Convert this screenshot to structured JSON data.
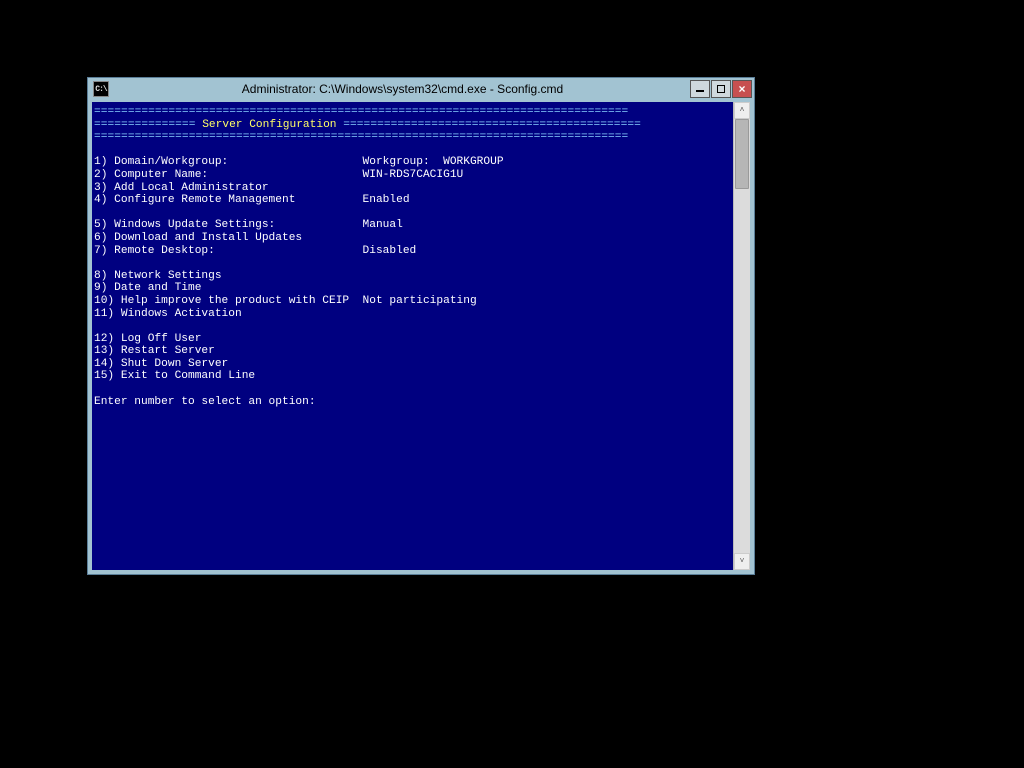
{
  "window": {
    "title": "Administrator: C:\\Windows\\system32\\cmd.exe - Sconfig.cmd"
  },
  "header": {
    "title_text": "Server Configuration"
  },
  "menu": {
    "items": [
      {
        "num": "1)",
        "label": "Domain/Workgroup:",
        "value": "Workgroup:  WORKGROUP"
      },
      {
        "num": "2)",
        "label": "Computer Name:",
        "value": "WIN-RDS7CACIG1U"
      },
      {
        "num": "3)",
        "label": "Add Local Administrator",
        "value": ""
      },
      {
        "num": "4)",
        "label": "Configure Remote Management",
        "value": "Enabled"
      },
      {
        "num": "",
        "label": "",
        "value": ""
      },
      {
        "num": "5)",
        "label": "Windows Update Settings:",
        "value": "Manual"
      },
      {
        "num": "6)",
        "label": "Download and Install Updates",
        "value": ""
      },
      {
        "num": "7)",
        "label": "Remote Desktop:",
        "value": "Disabled"
      },
      {
        "num": "",
        "label": "",
        "value": ""
      },
      {
        "num": "8)",
        "label": "Network Settings",
        "value": ""
      },
      {
        "num": "9)",
        "label": "Date and Time",
        "value": ""
      },
      {
        "num": "10)",
        "label": "Help improve the product with CEIP",
        "value": "Not participating"
      },
      {
        "num": "11)",
        "label": "Windows Activation",
        "value": ""
      },
      {
        "num": "",
        "label": "",
        "value": ""
      },
      {
        "num": "12)",
        "label": "Log Off User",
        "value": ""
      },
      {
        "num": "13)",
        "label": "Restart Server",
        "value": ""
      },
      {
        "num": "14)",
        "label": "Shut Down Server",
        "value": ""
      },
      {
        "num": "15)",
        "label": "Exit to Command Line",
        "value": ""
      }
    ]
  },
  "prompt": {
    "text": "Enter number to select an option:"
  },
  "icon_text": "C:\\"
}
